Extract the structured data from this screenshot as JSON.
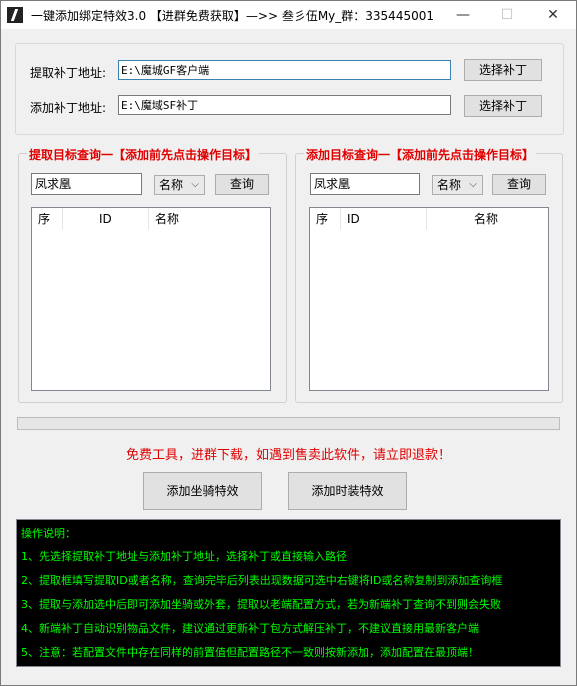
{
  "window": {
    "title": "一键添加绑定特效3.0   【进群免费获取】—>> 叁彡伍My_群：335445001",
    "controls": {
      "minimize": "—",
      "maximize": "☐",
      "close": "✕"
    }
  },
  "paths": {
    "extract_label": "提取补丁地址:",
    "extract_value": "E:\\魔城GF客户端",
    "extract_button": "选择补丁",
    "add_label": "添加补丁地址:",
    "add_value": "E:\\魔域SF补丁",
    "add_button": "选择补丁"
  },
  "extract_group": {
    "title": "提取目标查询一【添加前先点击操作目标】",
    "search_value": "凤求凰",
    "filter_selected": "名称",
    "query_button": "查询",
    "columns": [
      "序",
      "ID",
      "名称"
    ]
  },
  "add_group": {
    "title": "添加目标查询一【添加前先点击操作目标】",
    "search_value": "凤求凰",
    "filter_selected": "名称",
    "query_button": "查询",
    "columns": [
      "序",
      "ID",
      "名称"
    ]
  },
  "progress": {
    "value": 0
  },
  "notice": "免费工具，进群下载，如遇到售卖此软件，请立即退款！",
  "actions": {
    "mount_button": "添加坐骑特效",
    "fashion_button": "添加时装特效"
  },
  "instructions": {
    "lines": [
      "操作说明：",
      "1、先选择提取补丁地址与添加补丁地址，选择补丁或直接输入路径",
      "2、提取框填写提取ID或者名称，查询完毕后列表出现数据可选中右键将ID或名称复制到添加查询框",
      "3、提取与添加选中后即可添加坐骑或外套，提取以老端配置方式，若为新端补丁查询不到则会失败",
      "4、新端补丁自动识别物品文件，建议通过更新补丁包方式解压补丁，不建议直接用最新客户端",
      "5、注意：若配置文件中存在同样的前置值但配置路径不一致则按新添加，添加配置在最顶端！"
    ]
  },
  "colors": {
    "accent_red": "#e00000",
    "console_bg": "#000000",
    "console_text": "#00ff00"
  }
}
